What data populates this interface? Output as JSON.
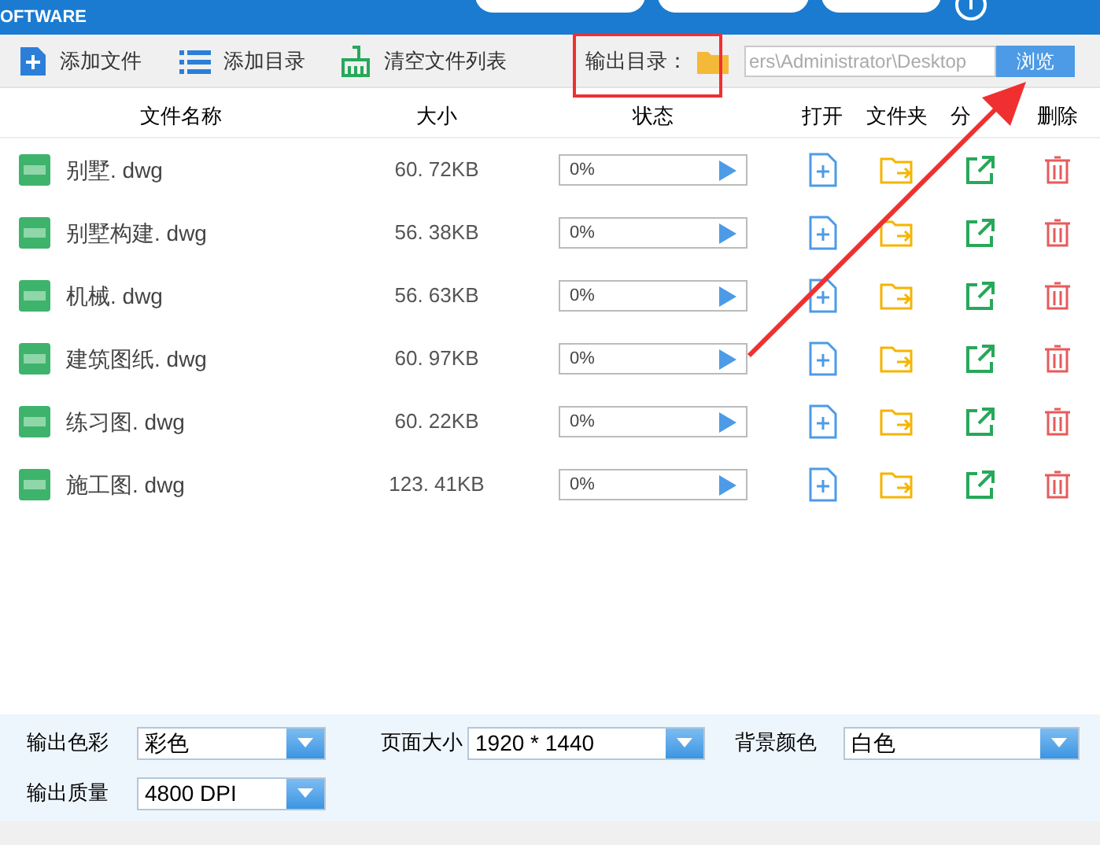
{
  "title_bar": {
    "title": "OFTWARE"
  },
  "toolbar": {
    "buttons": [
      {
        "kind": "add-file",
        "label": "添加文件"
      },
      {
        "kind": "add-dir",
        "label": "添加目录"
      },
      {
        "kind": "clear",
        "label": "清空文件列表"
      }
    ],
    "output_label": "输出目录：",
    "output_path": "ers\\Administrator\\Desktop",
    "browse": "浏览"
  },
  "table": {
    "columns": [
      "文件名称",
      "大小",
      "状态",
      "打开",
      "文件夹",
      "分",
      "删除"
    ],
    "rows": [
      {
        "name": "别墅. dwg",
        "size": "60. 72KB",
        "status": "0%",
        "level": 0
      },
      {
        "name": "别墅构建. dwg",
        "size": "56. 38KB",
        "status": "0%",
        "level": 0
      },
      {
        "name": "机械. dwg",
        "size": "56. 63KB",
        "status": "0%",
        "level": 0
      },
      {
        "name": "建筑图纸. dwg",
        "size": "60. 97KB",
        "status": "0%",
        "level": 0
      },
      {
        "name": "练习图. dwg",
        "size": "60. 22KB",
        "status": "0%",
        "level": 0
      },
      {
        "name": "施工图. dwg",
        "size": "123. 41KB",
        "status": "0%",
        "level": 0
      }
    ]
  },
  "settings": [
    {
      "label": "输出色彩",
      "value": "彩色"
    },
    {
      "label": "页面大小",
      "value": "1920 * 1440"
    },
    {
      "label": "背景颜色",
      "value": "白色"
    },
    {
      "label": "输出质量",
      "value": "4800 DPI"
    }
  ]
}
